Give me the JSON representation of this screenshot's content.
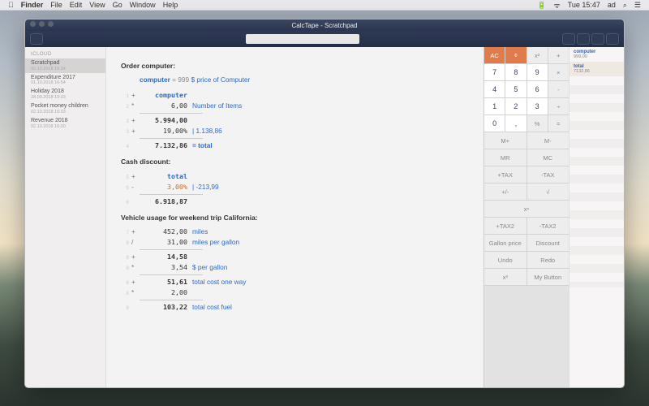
{
  "menubar": {
    "apple": "",
    "items": [
      "Finder",
      "File",
      "Edit",
      "View",
      "Go",
      "Window",
      "Help"
    ],
    "right": [
      "⌨",
      "☰",
      "≡",
      "🔋",
      "ᴡᴵᴾᴵ",
      "Tue 15:47",
      "ad",
      "⌕",
      "☰"
    ]
  },
  "window": {
    "title": "CalcTape - Scratchpad"
  },
  "sidebar": {
    "section": "ICLOUD",
    "items": [
      {
        "title": "Scratchpad",
        "sub": "02.10.2018 16:34",
        "selected": true
      },
      {
        "title": "Expenditure 2017",
        "sub": "01.10.2018 16:54"
      },
      {
        "title": "Holiday 2018",
        "sub": "28.09.2018 19:03"
      },
      {
        "title": "Pocket money children",
        "sub": "02.10.2018 16:03"
      },
      {
        "title": "Revenue 2018",
        "sub": "02.10.2018 16:00"
      }
    ]
  },
  "tape": {
    "s1": {
      "title": "Order computer:",
      "l1": "computer",
      "l1v": "= 999",
      "l1n": "$ price of Computer",
      "r1": {
        "ln": "1",
        "op": "+",
        "val": "computer"
      },
      "r2": {
        "ln": "2",
        "op": "*",
        "val": "6,00",
        "note": "Number of Items"
      },
      "r3": {
        "ln": "3",
        "op": "+",
        "val": "5.994,00"
      },
      "r4": {
        "ln": "3",
        "op": "+",
        "val": "19,00%",
        "side": "|  1.138,86"
      },
      "r5": {
        "ln": "4",
        "val": "7.132,86",
        "eq": "= total"
      }
    },
    "s2": {
      "title": "Cash discount:",
      "r1": {
        "ln": "5",
        "op": "+",
        "val": "total"
      },
      "r2": {
        "ln": "6",
        "op": "-",
        "val": "3,00%",
        "side": "|  -213,99"
      },
      "r3": {
        "ln": "6",
        "val": "6.918,87"
      }
    },
    "s3": {
      "title": "Vehicle usage for weekend trip California:",
      "r1": {
        "ln": "7",
        "op": "+",
        "val": "452,00",
        "note": "miles"
      },
      "r2": {
        "ln": "8",
        "op": "/",
        "val": "31,00",
        "note": "miles per gallon"
      },
      "r3": {
        "ln": "8",
        "op": "+",
        "val": "14,58"
      },
      "r4": {
        "ln": "8",
        "op": "*",
        "val": "3,54",
        "note": "$ per gallon"
      },
      "r5": {
        "ln": "8",
        "op": "+",
        "val": "51,61",
        "note": "total cost one way"
      },
      "r6": {
        "ln": "8",
        "op": "*",
        "val": "2,00"
      },
      "r7": {
        "ln": "8",
        "val": "103,22",
        "note": "total cost fuel"
      }
    }
  },
  "keypad": {
    "ac": "AC",
    "eye": "⌽",
    "sq": "x²",
    "plus": "+",
    "k7": "7",
    "k8": "8",
    "k9": "9",
    "mul": "×",
    "k4": "4",
    "k5": "5",
    "k6": "6",
    "min": "-",
    "k1": "1",
    "k2": "2",
    "k3": "3",
    "div": "÷",
    "k0": "0",
    "dot": ",",
    "pct": "%",
    "eq": "=",
    "mp": "M+",
    "mm": "M-",
    "mr": "MR",
    "mc": "MC",
    "pt": "+TAX",
    "mt": "-TAX",
    "pm": "+/-",
    "rt": "√",
    "xn": "xⁿ",
    "pt2": "+TAX2",
    "mt2": "-TAX2",
    "gp": "Gallon price",
    "dc": "Discount",
    "un": "Undo",
    "re": "Redo",
    "x3": "x³",
    "mb": "My Button"
  },
  "results": {
    "r1": {
      "label": "computer",
      "val": "999,00"
    },
    "r2": {
      "label": "total",
      "val": "7132,86"
    }
  }
}
